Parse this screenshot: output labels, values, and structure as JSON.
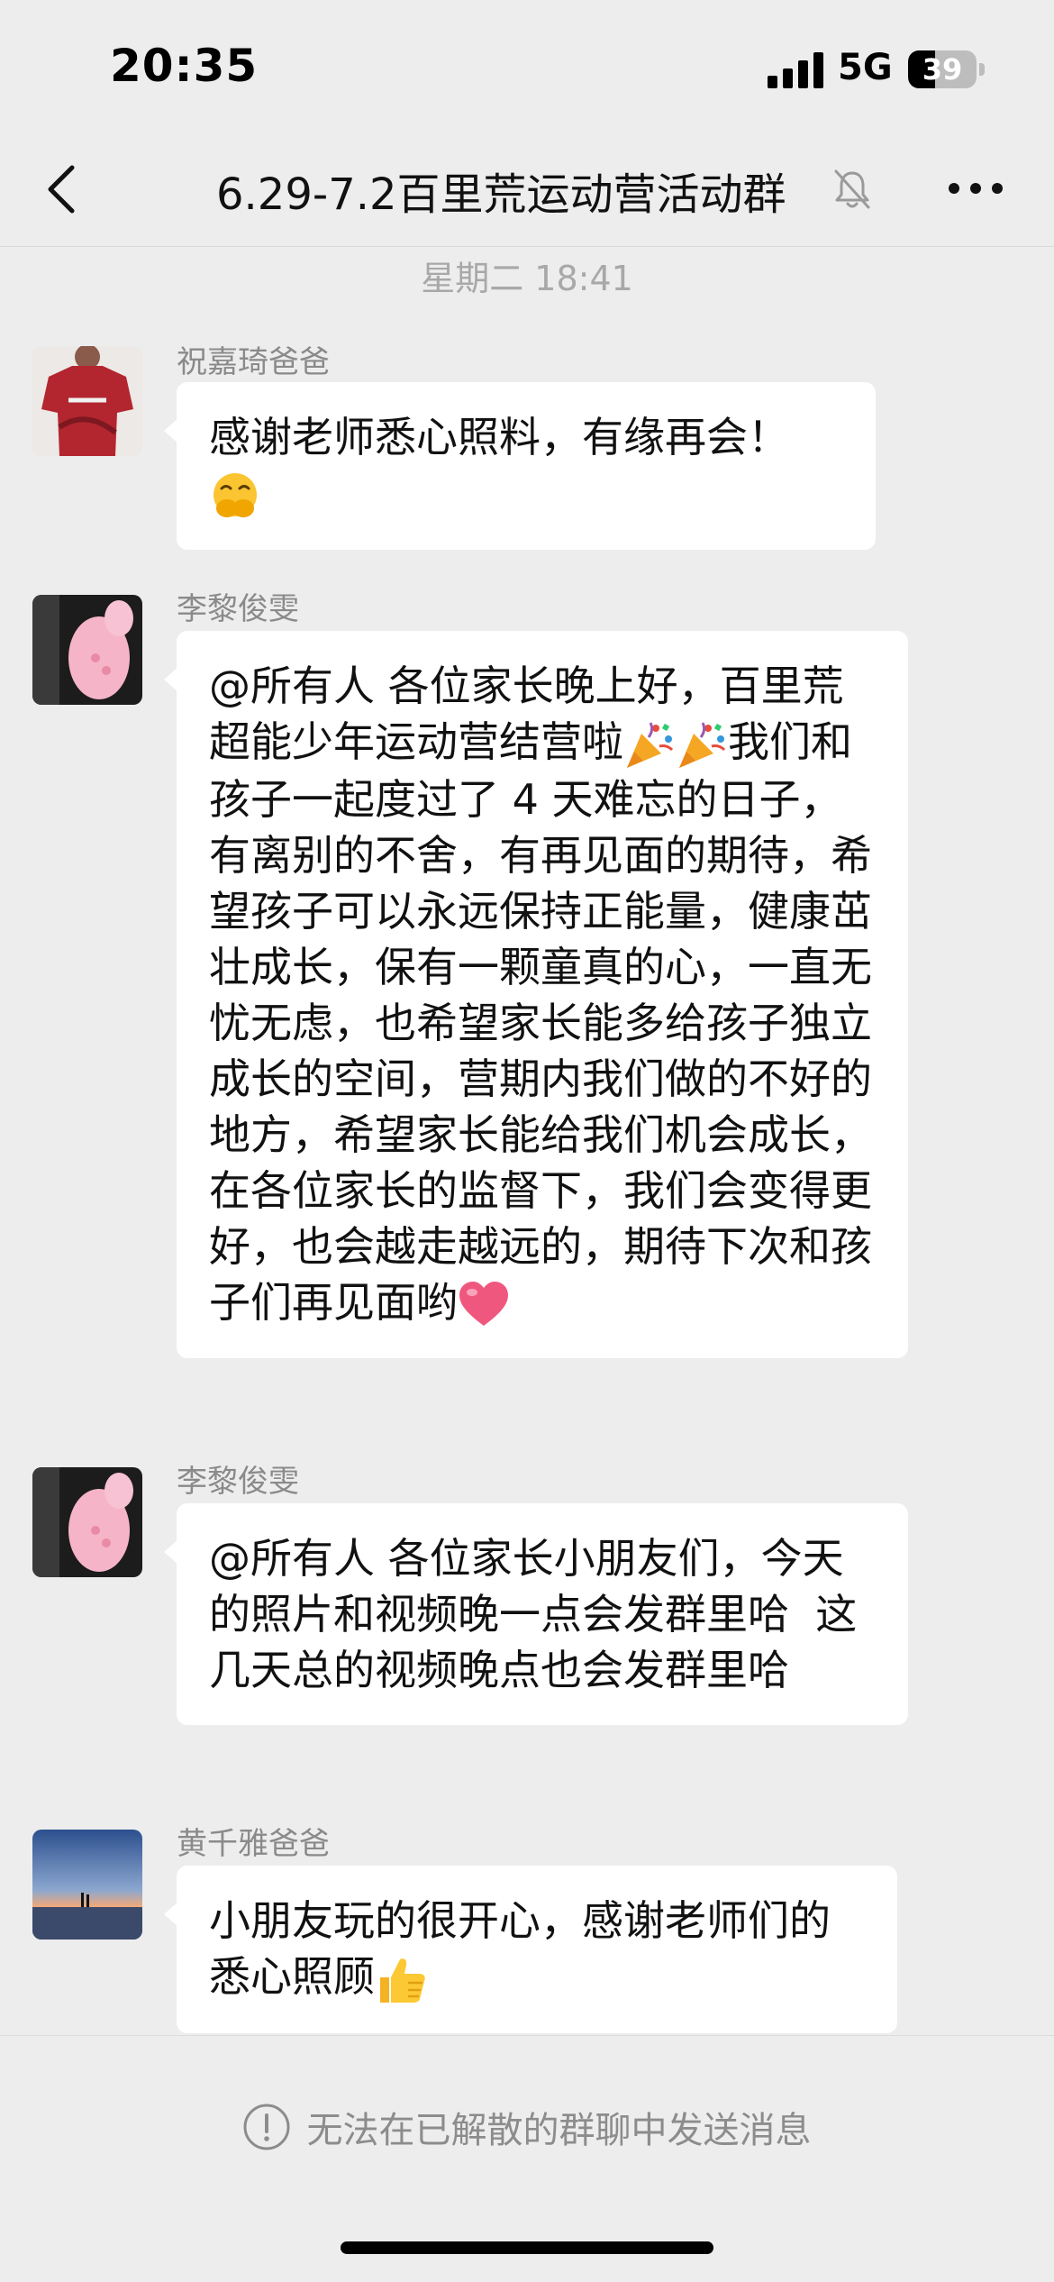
{
  "status_bar": {
    "time": "20:35",
    "network": "5G",
    "battery_level": "39",
    "battery_fraction": 0.39
  },
  "nav": {
    "back_icon": "chevron-left-icon",
    "title": "6.29-7.2百里荒运动营活动群",
    "mute_icon": "bell-slash-icon",
    "more_icon": "ellipsis-icon"
  },
  "chat": {
    "timestamp": "星期二 18:41",
    "messages": [
      {
        "sender": "祝嘉琦爸爸",
        "text": "感谢老师悉心照料，有缘再会！",
        "emoji": "hands-over-mouth-emoji"
      },
      {
        "sender": "李黎俊雯",
        "line1": "@所有人 各位家长晚上好，百里荒超能少年运动营结营啦",
        "emoji1": "party-popper-emoji",
        "emoji2": "party-popper-emoji",
        "line2": "我们和孩子一起度过了 4 天难忘的日子，有离别的不舍，有再见面的期待，希望孩子可以永远保持正能量，健康茁壮成长，保有一颗童真的心，一直无忧无虑，也希望家长能多给孩子独立成长的空间，营期内我们做的不好的地方，希望家长能给我们机会成长，在各位家长的监督下，我们会变得更好，也会越走越远的，期待下次和孩子们再见面哟",
        "emoji3": "heart-emoji"
      },
      {
        "sender": "李黎俊雯",
        "text": "@所有人 各位家长小朋友们，今天的照片和视频晚一点会发群里哈  这几天总的视频晚点也会发群里哈"
      },
      {
        "sender": "黄千雅爸爸",
        "text": "小朋友玩的很开心，感谢老师们的悉心照顾",
        "emoji": "thumbs-up-emoji"
      }
    ]
  },
  "footer": {
    "notice_icon": "exclamation-circle-icon",
    "notice": "无法在已解散的群聊中发送消息"
  }
}
